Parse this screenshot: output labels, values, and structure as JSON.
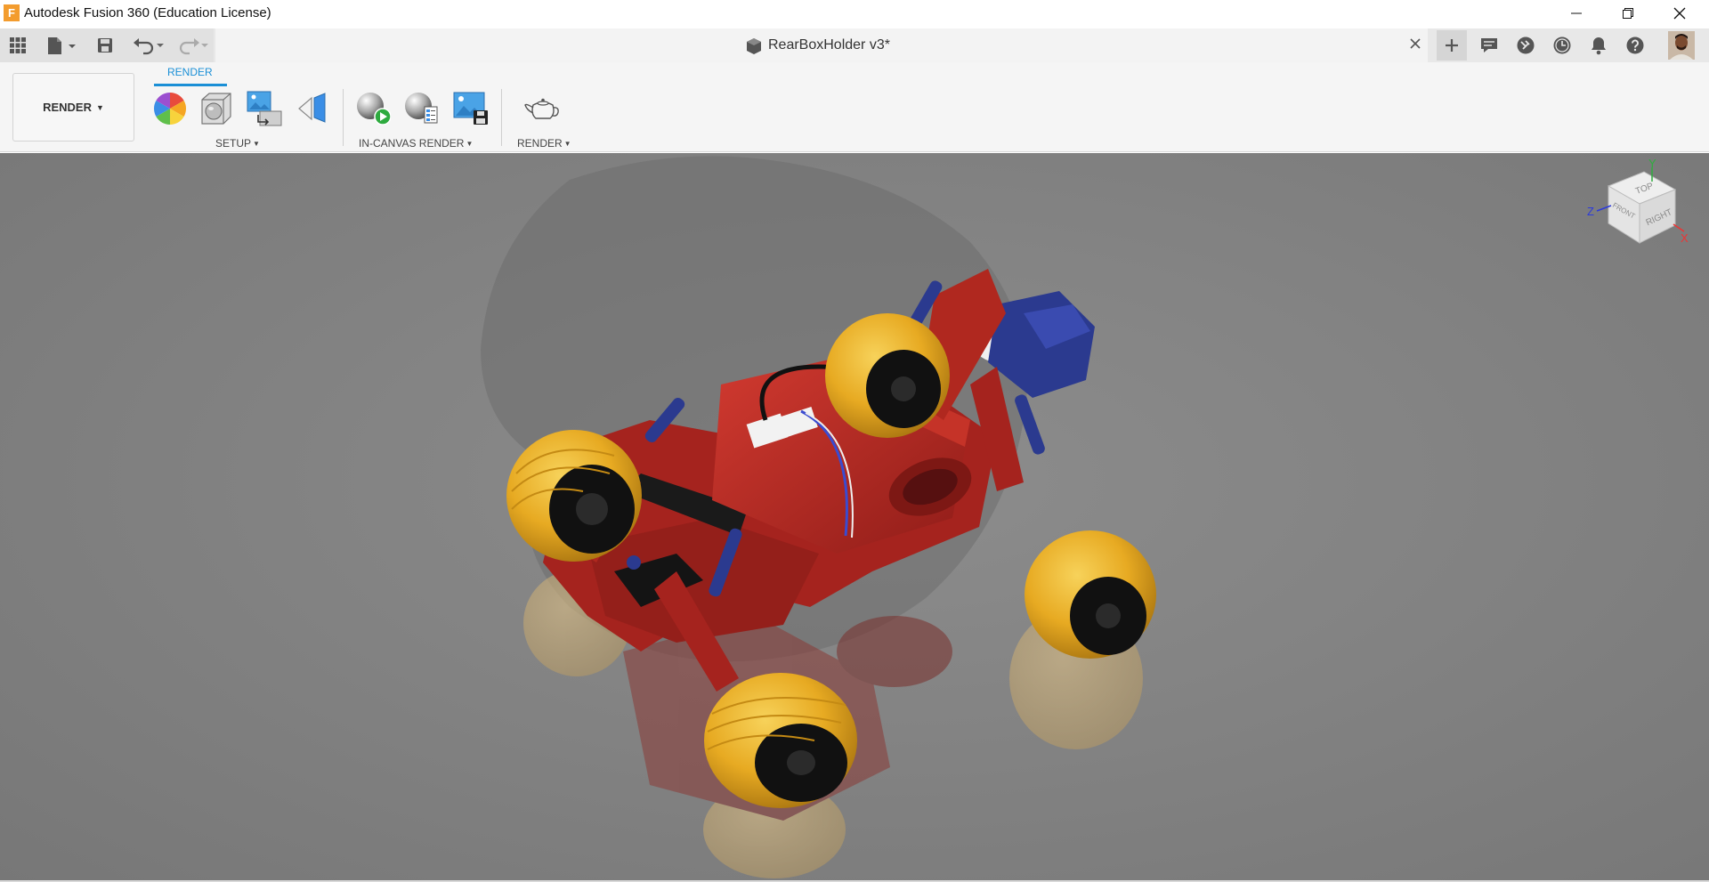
{
  "window": {
    "logo_letter": "F",
    "title": "Autodesk Fusion 360 (Education License)"
  },
  "appbar": {
    "document_title": "RearBoxHolder v3*"
  },
  "toolbar": {
    "workspace_label": "RENDER",
    "active_tab": "RENDER",
    "groups": {
      "setup": "SETUP",
      "in_canvas_render": "IN-CANVAS RENDER",
      "render": "RENDER"
    }
  },
  "viewcube": {
    "top_face": "TOP",
    "right_face": "RIGHT",
    "front_face": "FRONT",
    "axis_x": "X",
    "axis_y": "Y",
    "axis_z": "Z"
  },
  "colors": {
    "accent": "#1a8fd6",
    "chassis_red": "#b82a24",
    "tire_yellow": "#e7aa22",
    "part_blue": "#2b3a8f",
    "canvas_gray": "#858585"
  }
}
